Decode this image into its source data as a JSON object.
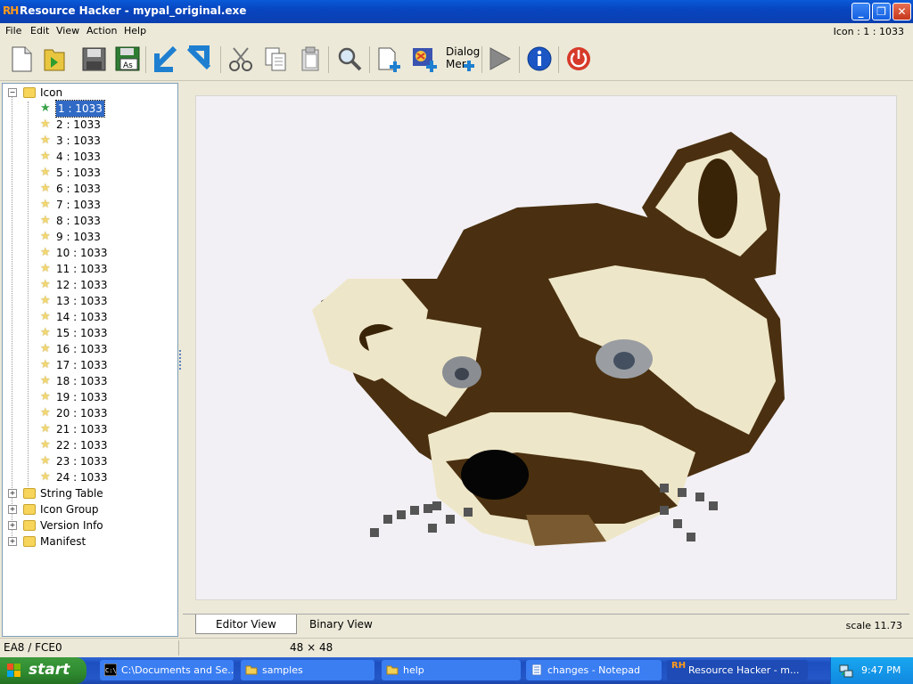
{
  "window": {
    "app_icon_text": "RH",
    "title": "Resource Hacker - mypal_original.exe",
    "min_label": "_",
    "max_label": "❐",
    "close_label": "✕"
  },
  "menu": {
    "items": [
      "File",
      "Edit",
      "View",
      "Action",
      "Help"
    ],
    "status_right": "Icon : 1 : 1033"
  },
  "toolbar": {
    "dialog_menu_line1": "Dialog",
    "dialog_menu_line2": "Mer",
    "icons": [
      "new-file-icon",
      "open-icon",
      "save-icon",
      "save-as-icon",
      "import-icon",
      "export-icon",
      "cut-icon",
      "copy-icon",
      "paste-icon",
      "find-icon",
      "add-resource-icon",
      "add-image-icon",
      "dialog-merger-icon",
      "compile-icon",
      "info-icon",
      "power-icon"
    ]
  },
  "tree": {
    "root_icon": {
      "label": "Icon",
      "expanded": true
    },
    "icon_items": [
      "1 : 1033",
      "2 : 1033",
      "3 : 1033",
      "4 : 1033",
      "5 : 1033",
      "6 : 1033",
      "7 : 1033",
      "8 : 1033",
      "9 : 1033",
      "10 : 1033",
      "11 : 1033",
      "12 : 1033",
      "13 : 1033",
      "14 : 1033",
      "15 : 1033",
      "16 : 1033",
      "17 : 1033",
      "18 : 1033",
      "19 : 1033",
      "20 : 1033",
      "21 : 1033",
      "22 : 1033",
      "23 : 1033",
      "24 : 1033"
    ],
    "selected_index": 0,
    "other_nodes": [
      "String Table",
      "Icon Group",
      "Version Info",
      "Manifest"
    ]
  },
  "editor": {
    "tabs": [
      "Editor View",
      "Binary View"
    ],
    "active_tab": "Editor View",
    "scale": "scale 11.73"
  },
  "statusbar": {
    "position": "EA8 / FCE0",
    "dimensions": "48 × 48"
  },
  "taskbar": {
    "start_label": "start",
    "tasks": [
      {
        "label": "C:\\Documents and Se...",
        "icon": "cmd-icon"
      },
      {
        "label": "samples",
        "icon": "folder-icon"
      },
      {
        "label": "help",
        "icon": "folder-icon"
      },
      {
        "label": "changes - Notepad",
        "icon": "notepad-icon"
      },
      {
        "label": "Resource Hacker - m...",
        "icon": "resource-hacker-icon"
      }
    ],
    "active_task": 4,
    "clock": "9:47 PM"
  },
  "colors": {
    "titlebar": "#0845c0",
    "selection": "#316ac5",
    "canvas_bg": "#f2f0f4",
    "fur_dark": "#4a3010",
    "fur_light": "#eee6c8",
    "taskbar": "#2457c8",
    "start_green": "#2f8a2f"
  }
}
